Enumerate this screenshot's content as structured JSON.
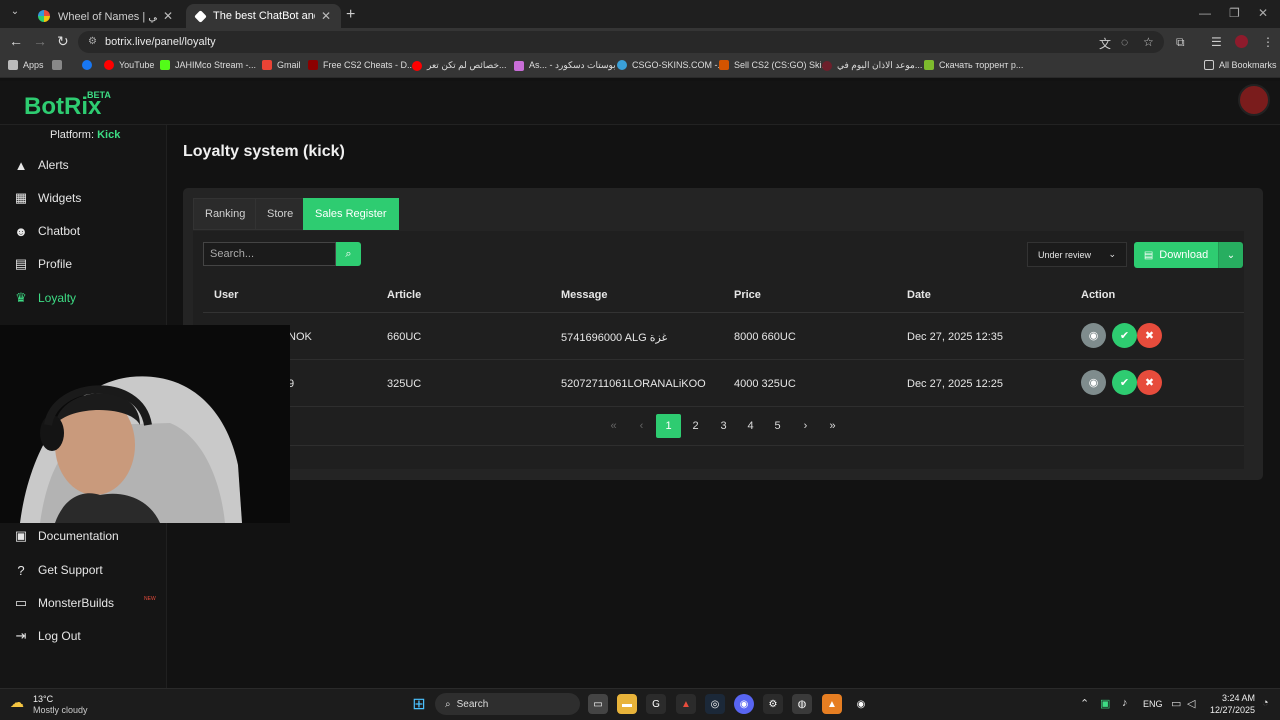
{
  "browser": {
    "tabs": [
      {
        "title": "Wheel of Names | سم العشوائي",
        "active": false
      },
      {
        "title": "The best ChatBot and Widgets",
        "active": true
      }
    ],
    "url": "botrix.live/panel/loyalty",
    "bookmarks": [
      "Apps",
      "YouTube",
      "JAHIMco Stream -...",
      "Gmail",
      "Free CS2 Cheats - D...",
      "خصائص لم تكن تعر...",
      "As... - بوستات دسكورد",
      "CSGO-SKINS.COM -...",
      "Sell CS2 (CS:GO) Ski...",
      "موعد الاذان اليوم في...",
      "Скачать торрент р..."
    ],
    "all_bookmarks": "All Bookmarks"
  },
  "brand": {
    "logo": "BotRix",
    "beta": "BETA"
  },
  "sidebar": {
    "platform_label": "Platform:",
    "platform_name": "Kick",
    "items": [
      {
        "label": "Alerts",
        "icon": "warning-icon"
      },
      {
        "label": "Widgets",
        "icon": "widgets-icon"
      },
      {
        "label": "Chatbot",
        "icon": "robot-icon"
      },
      {
        "label": "Profile",
        "icon": "id-card-icon"
      },
      {
        "label": "Loyalty",
        "icon": "trophy-icon",
        "active": true
      }
    ],
    "bottom_items": [
      {
        "label": "Documentation",
        "icon": "book-icon"
      },
      {
        "label": "Get Support",
        "icon": "question-icon"
      },
      {
        "label": "MonsterBuilds",
        "icon": "laptop-icon",
        "badge": "NEW"
      },
      {
        "label": "Log Out",
        "icon": "logout-icon"
      }
    ]
  },
  "main": {
    "title": "Loyalty system (kick)",
    "tabs": [
      "Ranking",
      "Store",
      "Sales Register"
    ],
    "active_tab": "Sales Register",
    "search_placeholder": "Search...",
    "status_filter": "Under review",
    "download_label": "Download",
    "columns": [
      "User",
      "Article",
      "Message",
      "Price",
      "Date",
      "Action"
    ],
    "rows": [
      {
        "user": "NOK",
        "article": "660UC",
        "message": "5741696000 ALG غزة",
        "price": "8000 660UC",
        "date": "Dec 27, 2025 12:35"
      },
      {
        "user": "9",
        "article": "325UC",
        "message": "52072711061LORANALiKOO",
        "price": "4000 325UC",
        "date": "Dec 27, 2025 12:25"
      }
    ],
    "pagination": {
      "pages": [
        "1",
        "2",
        "3",
        "4",
        "5"
      ],
      "current": "1"
    }
  },
  "taskbar": {
    "weather_temp": "13°C",
    "weather_desc": "Mostly cloudy",
    "search_label": "Search",
    "lang": "ENG",
    "time": "3:24 AM",
    "date": "12/27/2025"
  },
  "colors": {
    "accent": "#2ecc71",
    "danger": "#e74c3c",
    "muted": "#7f8c8d"
  }
}
